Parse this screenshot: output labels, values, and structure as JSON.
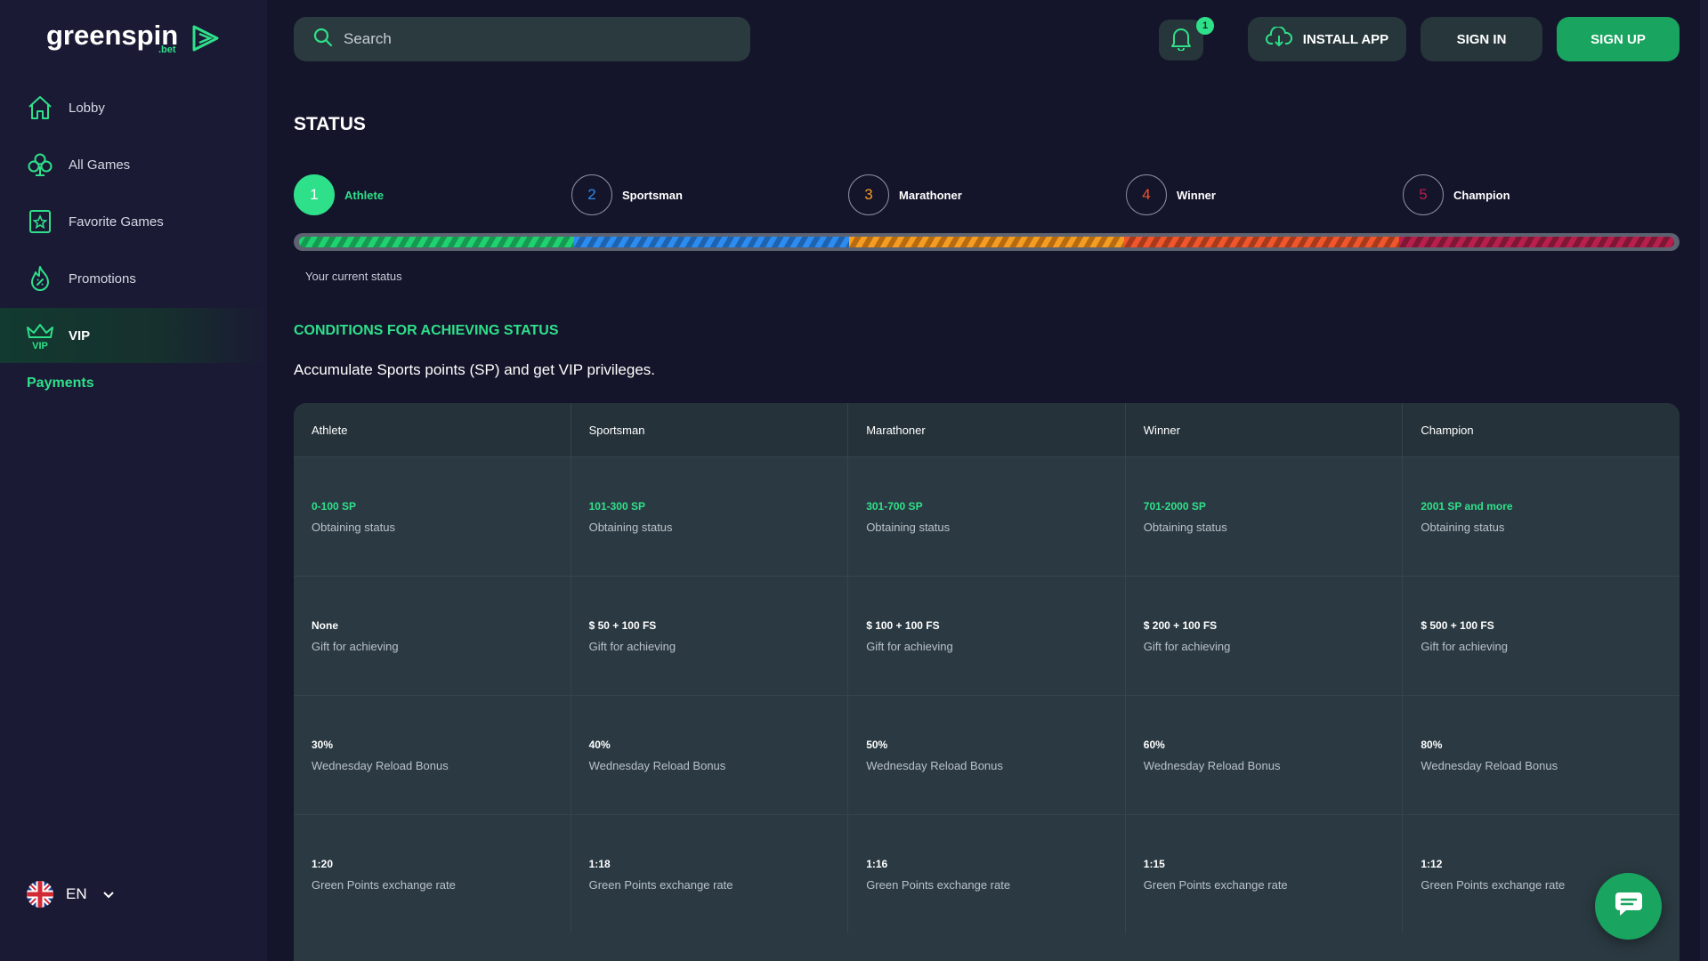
{
  "brand": {
    "name": "greenspin",
    "sub": ".bet"
  },
  "sidebar": {
    "items": [
      {
        "label": "Lobby",
        "icon": "home-icon"
      },
      {
        "label": "All Games",
        "icon": "club-icon"
      },
      {
        "label": "Favorite Games",
        "icon": "favorite-icon"
      },
      {
        "label": "Promotions",
        "icon": "fire-icon"
      },
      {
        "label": "VIP",
        "icon": "crown-icon",
        "active": true
      }
    ],
    "payments": "Payments",
    "language": "EN"
  },
  "header": {
    "search_placeholder": "Search",
    "notification_count": "1",
    "install_app": "INSTALL APP",
    "sign_in": "SIGN IN",
    "sign_up": "SIGN UP"
  },
  "status": {
    "title": "STATUS",
    "current_index": 0,
    "current_label": "Your current status",
    "steps": [
      {
        "num": "1",
        "name": "Athlete",
        "color": "#2fe08a"
      },
      {
        "num": "2",
        "name": "Sportsman",
        "color": "#2c8cf0"
      },
      {
        "num": "3",
        "name": "Marathoner",
        "color": "#f59d22"
      },
      {
        "num": "4",
        "name": "Winner",
        "color": "#f0552c"
      },
      {
        "num": "5",
        "name": "Champion",
        "color": "#b81f4c"
      }
    ]
  },
  "conditions": {
    "title": "CONDITIONS FOR ACHIEVING STATUS",
    "description": "Accumulate Sports points (SP) and get VIP privileges.",
    "columns": [
      "Athlete",
      "Sportsman",
      "Marathoner",
      "Winner",
      "Champion"
    ],
    "rows": [
      {
        "desc": "Obtaining status",
        "highlight": true,
        "values": [
          "0-100 SP",
          "101-300 SP",
          "301-700 SP",
          "701-2000 SP",
          "2001 SP and more"
        ]
      },
      {
        "desc": "Gift for achieving",
        "highlight": false,
        "values": [
          "None",
          "$ 50 + 100 FS",
          "$ 100 + 100 FS",
          "$ 200 + 100 FS",
          "$ 500 + 100 FS"
        ]
      },
      {
        "desc": "Wednesday Reload Bonus",
        "highlight": false,
        "values": [
          "30%",
          "40%",
          "50%",
          "60%",
          "80%"
        ]
      },
      {
        "desc": "Green Points exchange rate",
        "highlight": false,
        "values": [
          "1:20",
          "1:18",
          "1:16",
          "1:15",
          "1:12"
        ]
      }
    ]
  },
  "colors": {
    "accent": "#2fe08a",
    "background": "#14142a",
    "sidebar": "#1a1a34"
  }
}
